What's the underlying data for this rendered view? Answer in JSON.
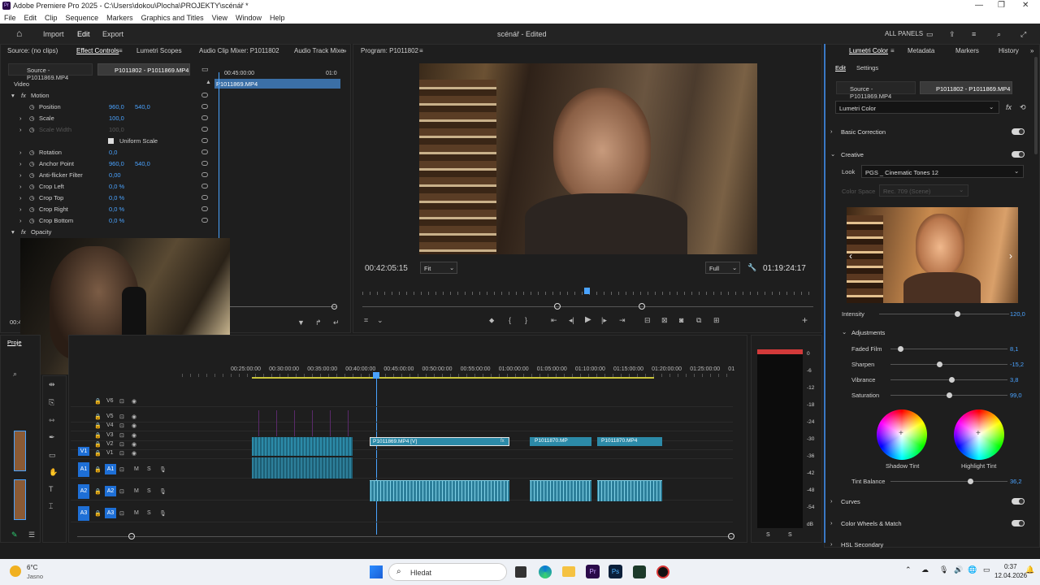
{
  "window": {
    "title": "Adobe Premiere Pro 2025 - C:\\Users\\dokou\\Plocha\\PROJEKTY\\scénář *",
    "app_icon": "Pr"
  },
  "menu": [
    "File",
    "Edit",
    "Clip",
    "Sequence",
    "Markers",
    "Graphics and Titles",
    "View",
    "Window",
    "Help"
  ],
  "workspace": {
    "home_icon": "home-icon",
    "tabs": [
      "Import",
      "Edit",
      "Export"
    ],
    "active_tab": "Edit",
    "project_title": "scénář",
    "project_status": "- Edited",
    "all_panels": "ALL PANELS"
  },
  "left_panel": {
    "tabs": [
      "Source: (no clips)",
      "Effect Controls",
      "Lumetri Scopes",
      "Audio Clip Mixer: P1011802",
      "Audio Track Mixe"
    ],
    "clip_tabs": [
      "Source - P1011869.MP4",
      "P1011802 - P1011869.MP4"
    ],
    "timecode_mini": "00:45:00:00",
    "timecode_end": "01:0",
    "clip_name": "P1011869.MP4",
    "section_video": "Video",
    "fx_motion": "Motion",
    "properties": [
      {
        "name": "Position",
        "v1": "960,0",
        "v2": "540,0"
      },
      {
        "name": "Scale",
        "v1": "100,0",
        "v2": ""
      },
      {
        "name": "Scale Width",
        "v1": "100,0",
        "v2": ""
      },
      {
        "name": "Uniform Scale",
        "v1": "",
        "v2": ""
      },
      {
        "name": "Rotation",
        "v1": "0,0",
        "v2": ""
      },
      {
        "name": "Anchor Point",
        "v1": "960,0",
        "v2": "540,0"
      },
      {
        "name": "Anti-flicker Filter",
        "v1": "0,00",
        "v2": ""
      },
      {
        "name": "Crop Left",
        "v1": "0,0 %",
        "v2": ""
      },
      {
        "name": "Crop Top",
        "v1": "0,0 %",
        "v2": ""
      },
      {
        "name": "Crop Right",
        "v1": "0,0 %",
        "v2": ""
      },
      {
        "name": "Crop Bottom",
        "v1": "0,0 %",
        "v2": ""
      }
    ],
    "fx_opacity": "Opacity",
    "current_tc_partial": "00:4"
  },
  "program": {
    "title": "Program: P1011802",
    "timecode": "00:42:05:15",
    "fit": "Fit",
    "quality": "Full",
    "duration": "01:19:24:17"
  },
  "project_tab": "Proje",
  "timeline": {
    "ruler": [
      "00:25:00:00",
      "00:30:00:00",
      "00:35:00:00",
      "00:40:00:00",
      "00:45:00:00",
      "00:50:00:00",
      "00:55:00:00",
      "01:00:00:00",
      "01:05:00:00",
      "01:10:00:00",
      "01:15:00:00",
      "01:20:00:00",
      "01:25:00:00",
      "01"
    ],
    "video_tracks": [
      "V6",
      "V5",
      "V4",
      "V3",
      "V2",
      "V1"
    ],
    "audio_tracks": [
      "A1",
      "A2",
      "A3"
    ],
    "src_v": "V1",
    "src_a": "A1",
    "clips": [
      "P1011869.MP4 [V]",
      "P1011870.MP",
      "P1011870.MP4"
    ],
    "fx_badge": "fx",
    "meter_db": [
      "0",
      "-6",
      "-12",
      "-18",
      "-24",
      "-30",
      "-36",
      "-42",
      "-48",
      "-54",
      "dB"
    ],
    "meter_solo": [
      "S",
      "S"
    ]
  },
  "lumetri": {
    "tabs": [
      "Lumetri Color",
      "Metadata",
      "Markers",
      "History"
    ],
    "subtabs": [
      "Edit",
      "Settings"
    ],
    "clip_tabs": [
      "Source - P1011869.MP4",
      "P1011802 - P1011869.MP4"
    ],
    "effect": "Lumetri Color",
    "sections": {
      "basic": "Basic Correction",
      "creative": "Creative",
      "curves": "Curves",
      "wheels": "Color Wheels & Match",
      "hsl": "HSL Secondary"
    },
    "look_label": "Look",
    "look_value": "PGS _ Cinematic Tones 12",
    "colorspace_label": "Color Space",
    "colorspace_value": "Rec. 709 (Scene)",
    "intensity": {
      "label": "Intensity",
      "value": "120,0",
      "frac": 0.6
    },
    "adjustments": "Adjustments",
    "sliders": [
      {
        "label": "Faded Film",
        "value": "8,1",
        "frac": 0.08
      },
      {
        "label": "Sharpen",
        "value": "-15,2",
        "frac": 0.42
      },
      {
        "label": "Vibrance",
        "value": "3,8",
        "frac": 0.52
      },
      {
        "label": "Saturation",
        "value": "99,0",
        "frac": 0.5
      }
    ],
    "shadow_tint": "Shadow Tint",
    "highlight_tint": "Highlight Tint",
    "tint_balance": {
      "label": "Tint Balance",
      "value": "36,2",
      "frac": 0.68
    }
  },
  "taskbar": {
    "temp": "6°C",
    "weather": "Jasno",
    "search": "Hledat",
    "time": "0:37",
    "date": "12.04.2026"
  },
  "colors": {
    "accent": "#4aa3ff",
    "clip": "#2c8aa8",
    "track_src": "#1e6fd6"
  }
}
